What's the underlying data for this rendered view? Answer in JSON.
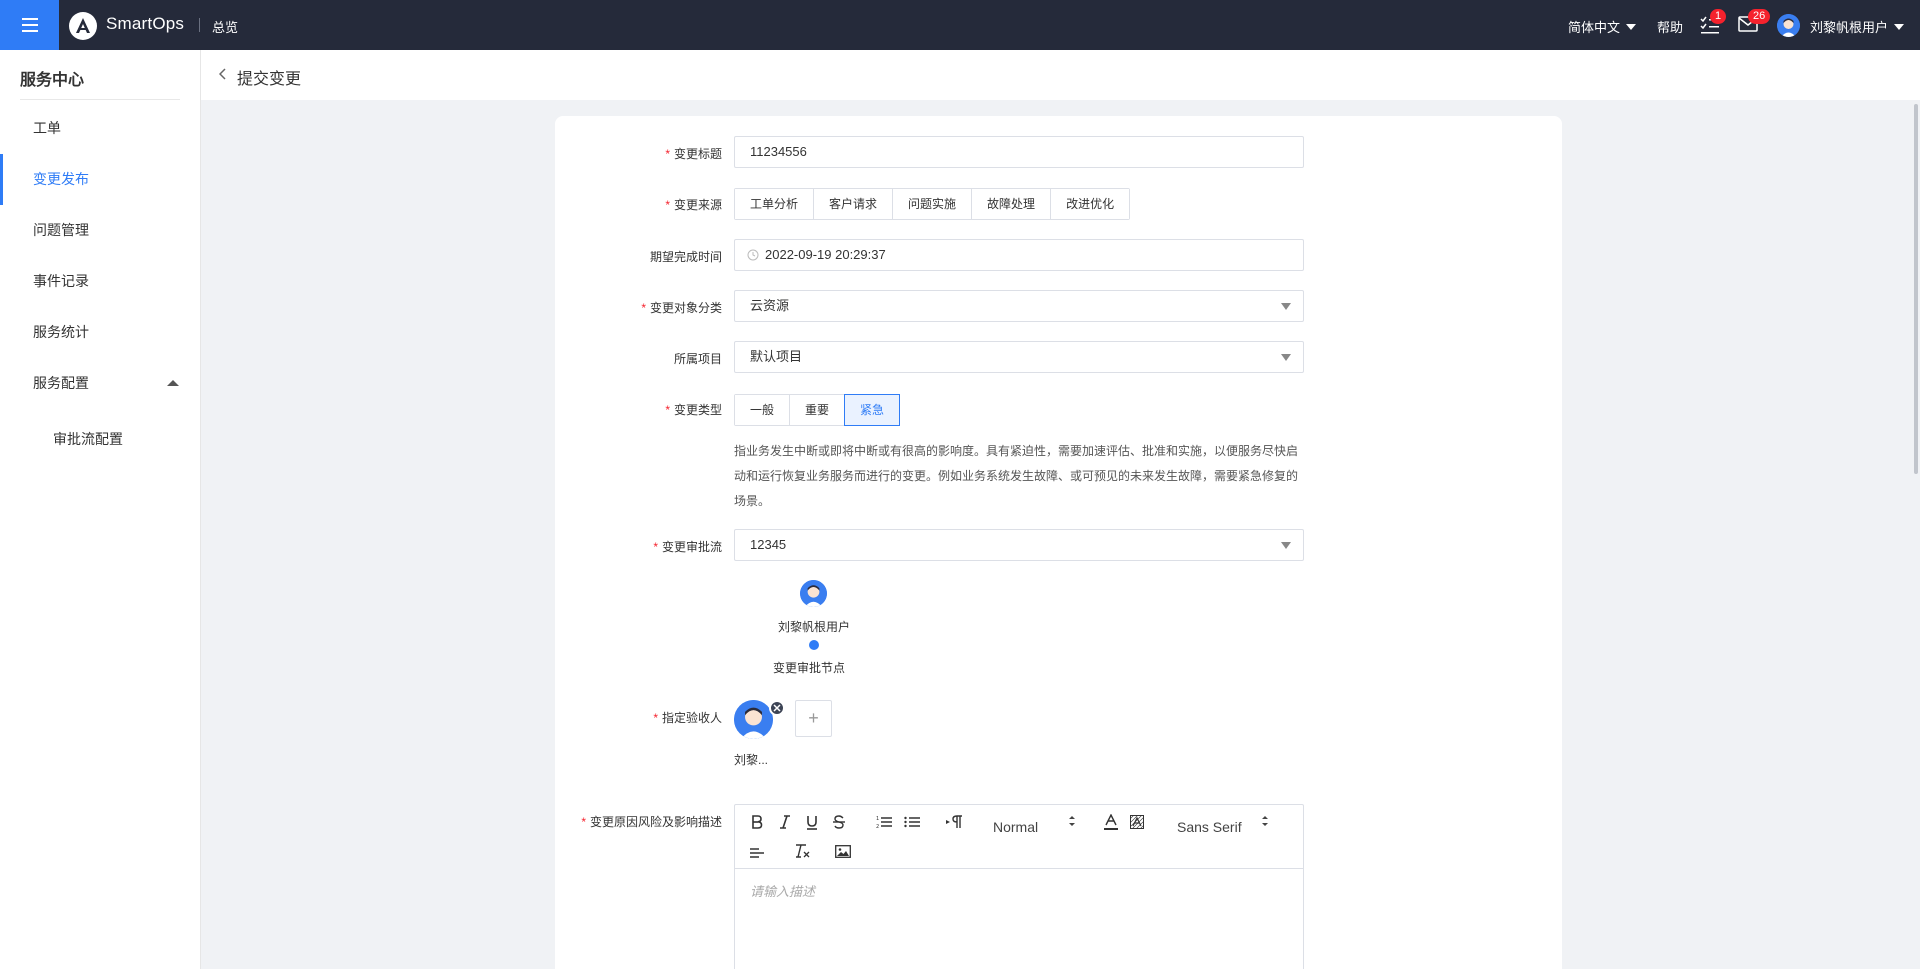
{
  "topbar": {
    "brand": "SmartOps",
    "overview": "总览",
    "language": "简体中文",
    "help": "帮助",
    "todo_count": "1",
    "mail_count": "26",
    "user": "刘黎帆根用户"
  },
  "sidebar": {
    "title": "服务中心",
    "items": [
      {
        "label": "工单"
      },
      {
        "label": "变更发布"
      },
      {
        "label": "问题管理"
      },
      {
        "label": "事件记录"
      },
      {
        "label": "服务统计"
      },
      {
        "label": "服务配置"
      },
      {
        "label": "审批流配置"
      }
    ]
  },
  "page": {
    "title": "提交变更"
  },
  "form": {
    "title_label": "变更标题",
    "title_value": "11234556",
    "source_label": "变更来源",
    "source_options": [
      "工单分析",
      "客户请求",
      "问题实施",
      "故障处理",
      "改进优化"
    ],
    "deadline_label": "期望完成时间",
    "deadline_value": "2022-09-19 20:29:37",
    "object_label": "变更对象分类",
    "object_value": "云资源",
    "project_label": "所属项目",
    "project_value": "默认项目",
    "type_label": "变更类型",
    "type_options": [
      "一般",
      "重要",
      "紧急"
    ],
    "type_selected": "紧急",
    "type_desc": "指业务发生中断或即将中断或有很高的影响度。具有紧迫性，需要加速评估、批准和实施，以便服务尽快启动和运行恢复业务服务而进行的变更。例如业务系统发生故障、或可预见的未来发生故障，需要紧急修复的场景。",
    "flow_label": "变更审批流",
    "flow_value": "12345",
    "flow_user": "刘黎帆根用户",
    "flow_node": "变更审批节点",
    "acceptor_label": "指定验收人",
    "acceptor_name": "刘黎...",
    "acceptor_add": "+",
    "reason_label": "变更原因风险及影响描述",
    "editor_size": "Normal",
    "editor_font": "Sans Serif",
    "editor_placeholder": "请输入描述"
  },
  "colors": {
    "accent": "#2f7cf6",
    "topbar": "#252a3a",
    "required": "#f5222d"
  }
}
